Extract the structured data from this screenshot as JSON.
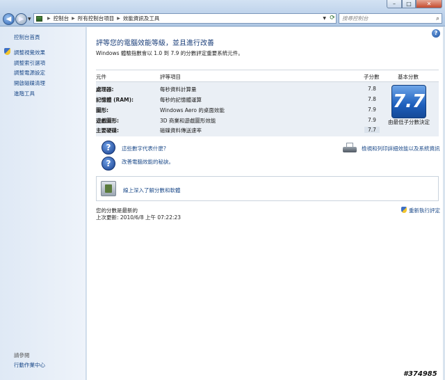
{
  "window": {
    "minimize": "–",
    "maximize": "□",
    "close": "✕"
  },
  "address": {
    "crumbs": [
      "控制台",
      "所有控制台項目",
      "效能資訊及工具"
    ],
    "search_placeholder": "搜尋控制台"
  },
  "sidebar": {
    "home": "控制台首頁",
    "items": [
      {
        "label": "調整視覺效果"
      },
      {
        "label": "調整索引選項"
      },
      {
        "label": "調整電源設定"
      },
      {
        "label": "開啟磁碟清理"
      },
      {
        "label": "進階工具"
      }
    ],
    "see_also": "請參閱",
    "action_center": "行動作業中心"
  },
  "main": {
    "title": "評等您的電腦效能等級，並且進行改善",
    "description": "Windows 體驗指數會以 1.0 到 7.9 的分數評定重要系統元件。",
    "table": {
      "headers": {
        "component": "元件",
        "rated": "評等項目",
        "subscore": "子分數",
        "base": "基本分數"
      },
      "rows": [
        {
          "component": "處理器:",
          "rated": "每秒資料計算量",
          "subscore": "7.8"
        },
        {
          "component": "記憶體 (RAM):",
          "rated": "每秒的記憶體運算",
          "subscore": "7.8"
        },
        {
          "component": "圖形:",
          "rated": "Windows Aero 的桌面效能",
          "subscore": "7.9"
        },
        {
          "component": "遊戲圖形:",
          "rated": "3D 商業和遊戲圖形效能",
          "subscore": "7.9"
        },
        {
          "component": "主要硬碟:",
          "rated": "磁碟資料傳送速率",
          "subscore": "7.7"
        }
      ],
      "base_score": "7.7",
      "base_caption": "由最低子分數決定"
    },
    "links": {
      "what_numbers": "這些數字代表什麼?",
      "improve_tips": "改善電腦效能的秘訣。",
      "print_details": "檢視和列印詳細效能以及系統資訊",
      "learn_more": "線上深入了解分數和軟體"
    },
    "status": {
      "current": "您的分數是最新的",
      "last_update": "上次更新: 2010/6/8 上午 07:22:23",
      "rerun": "重新執行評定"
    }
  },
  "watermark": "#374985"
}
